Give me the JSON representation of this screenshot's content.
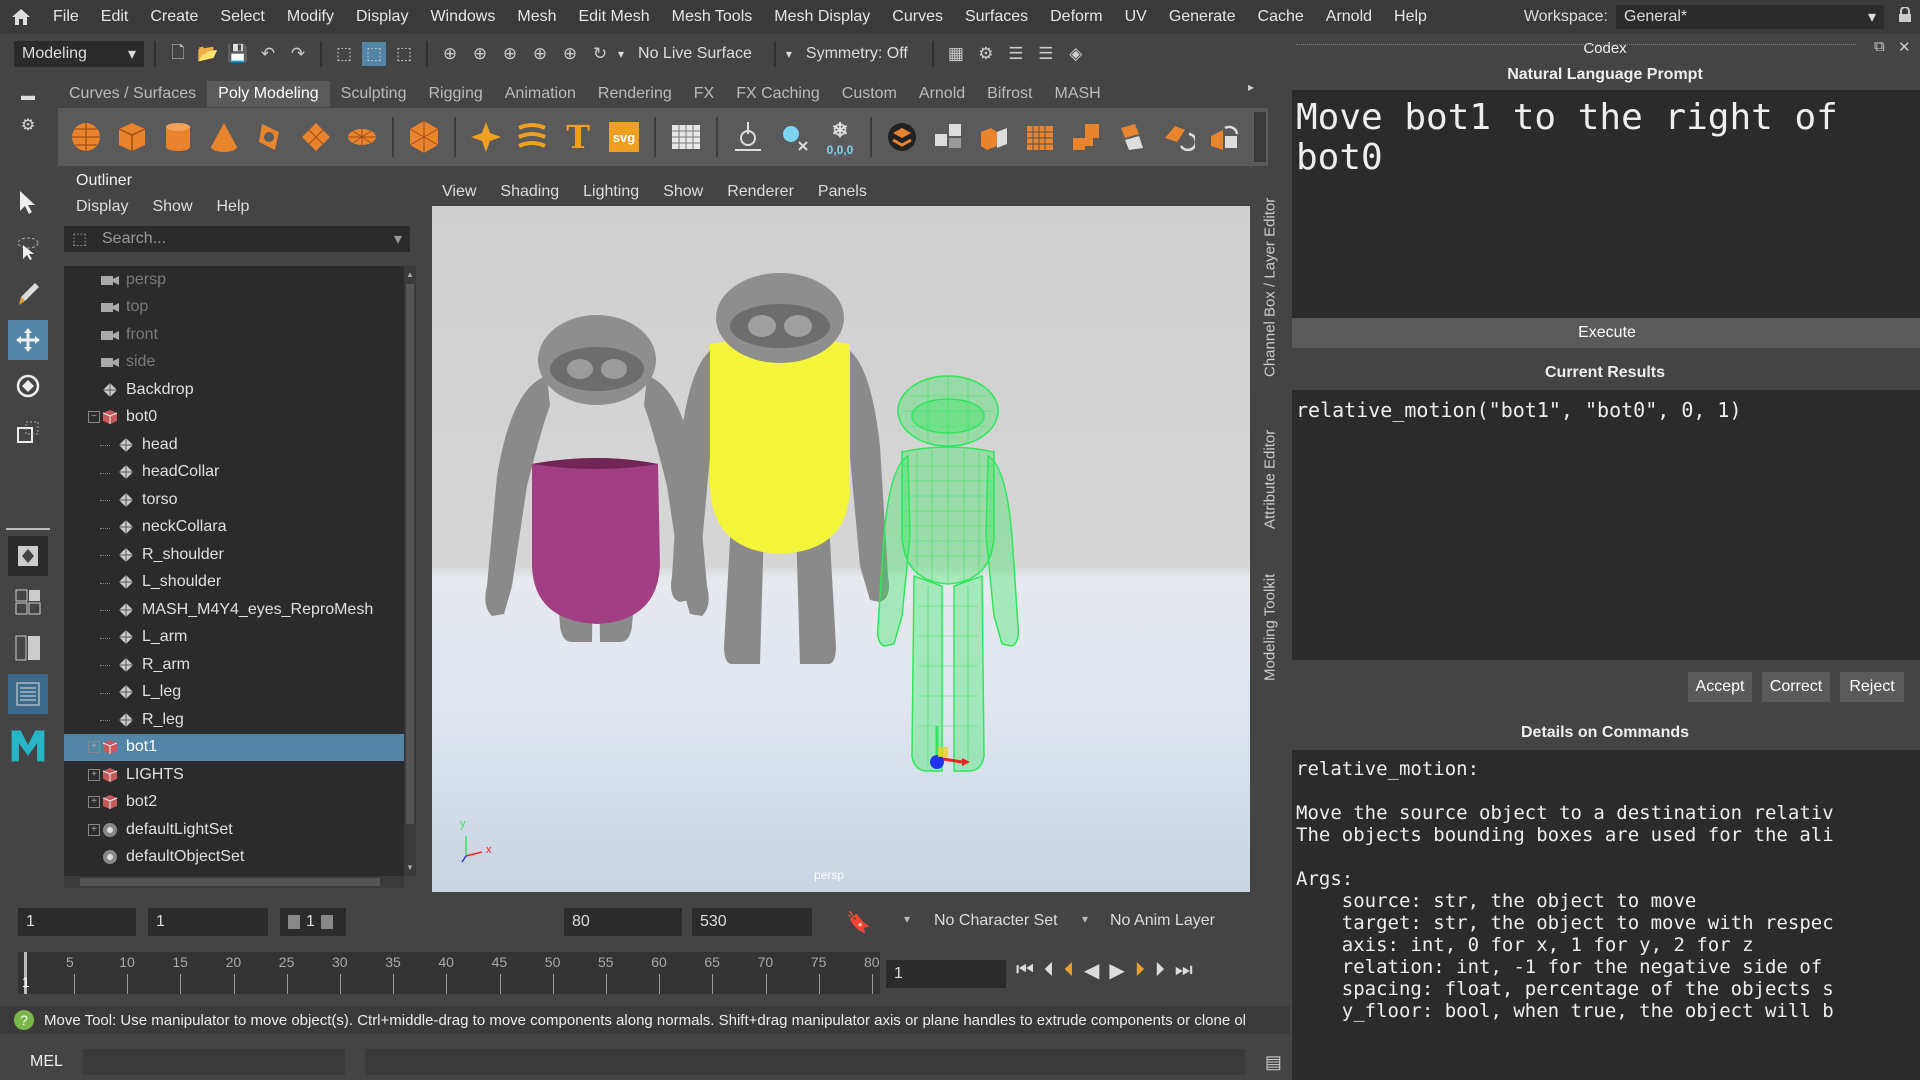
{
  "menubar": {
    "items": [
      "File",
      "Edit",
      "Create",
      "Select",
      "Modify",
      "Display",
      "Windows",
      "Mesh",
      "Edit Mesh",
      "Mesh Tools",
      "Mesh Display",
      "Curves",
      "Surfaces",
      "Deform",
      "UV",
      "Generate",
      "Cache",
      "Arnold",
      "Help"
    ],
    "workspace_label": "Workspace:",
    "workspace_value": "General*"
  },
  "statusline": {
    "mode": "Modeling",
    "live_surface": "No Live Surface",
    "symmetry": "Symmetry: Off"
  },
  "shelf": {
    "tabs": [
      "Curves / Surfaces",
      "Poly Modeling",
      "Sculpting",
      "Rigging",
      "Animation",
      "Rendering",
      "FX",
      "FX Caching",
      "Custom",
      "Arnold",
      "Bifrost",
      "MASH"
    ],
    "active_tab": "Poly Modeling",
    "text_icon": "T",
    "svg_icon": "svg",
    "coords_icon": "0,0,0"
  },
  "outliner": {
    "title": "Outliner",
    "menu": [
      "Display",
      "Show",
      "Help"
    ],
    "search_placeholder": "Search...",
    "tree": [
      {
        "label": "persp",
        "depth": 0,
        "icon": "camera-icon",
        "dim": true,
        "expander": ""
      },
      {
        "label": "top",
        "depth": 0,
        "icon": "camera-icon",
        "dim": true,
        "expander": ""
      },
      {
        "label": "front",
        "depth": 0,
        "icon": "camera-icon",
        "dim": true,
        "expander": ""
      },
      {
        "label": "side",
        "depth": 0,
        "icon": "camera-icon",
        "dim": true,
        "expander": ""
      },
      {
        "label": "Backdrop",
        "depth": 0,
        "icon": "mesh-icon",
        "dim": false,
        "expander": ""
      },
      {
        "label": "bot0",
        "depth": 0,
        "icon": "group-icon",
        "dim": false,
        "expander": "−"
      },
      {
        "label": "head",
        "depth": 1,
        "icon": "mesh-icon",
        "dim": false,
        "expander": ""
      },
      {
        "label": "headCollar",
        "depth": 1,
        "icon": "mesh-icon",
        "dim": false,
        "expander": ""
      },
      {
        "label": "torso",
        "depth": 1,
        "icon": "mesh-icon",
        "dim": false,
        "expander": ""
      },
      {
        "label": "neckCollara",
        "depth": 1,
        "icon": "mesh-icon",
        "dim": false,
        "expander": ""
      },
      {
        "label": "R_shoulder",
        "depth": 1,
        "icon": "mesh-icon",
        "dim": false,
        "expander": ""
      },
      {
        "label": "L_shoulder",
        "depth": 1,
        "icon": "mesh-icon",
        "dim": false,
        "expander": ""
      },
      {
        "label": "MASH_M4Y4_eyes_ReproMesh",
        "depth": 1,
        "icon": "mesh-icon",
        "dim": false,
        "expander": ""
      },
      {
        "label": "L_arm",
        "depth": 1,
        "icon": "mesh-icon",
        "dim": false,
        "expander": ""
      },
      {
        "label": "R_arm",
        "depth": 1,
        "icon": "mesh-icon",
        "dim": false,
        "expander": ""
      },
      {
        "label": "L_leg",
        "depth": 1,
        "icon": "mesh-icon",
        "dim": false,
        "expander": ""
      },
      {
        "label": "R_leg",
        "depth": 1,
        "icon": "mesh-icon",
        "dim": false,
        "expander": ""
      },
      {
        "label": "bot1",
        "depth": 0,
        "icon": "group-icon",
        "dim": false,
        "expander": "+",
        "selected": true
      },
      {
        "label": "LIGHTS",
        "depth": 0,
        "icon": "group-icon",
        "dim": false,
        "expander": "+"
      },
      {
        "label": "bot2",
        "depth": 0,
        "icon": "group-icon",
        "dim": false,
        "expander": "+"
      },
      {
        "label": "defaultLightSet",
        "depth": 0,
        "icon": "set-icon",
        "dim": false,
        "expander": "+"
      },
      {
        "label": "defaultObjectSet",
        "depth": 0,
        "icon": "set-icon",
        "dim": false,
        "expander": ""
      }
    ]
  },
  "viewport": {
    "menu": [
      "View",
      "Shading",
      "Lighting",
      "Show",
      "Renderer",
      "Panels"
    ],
    "camera_label": "persp",
    "axis_y": "y",
    "axis_x": "x",
    "bot_colors": {
      "bot0_torso": "#a23e83",
      "bot1_torso": "#f4f53a",
      "wire": "#2ee85a"
    }
  },
  "sidetabs": {
    "channel_box": "Channel Box / Layer Editor",
    "attribute_editor": "Attribute Editor",
    "modeling_toolkit": "Modeling Toolkit"
  },
  "timeline": {
    "start": "1",
    "range_start": "1",
    "range_field": "1",
    "range_end": "80",
    "end": "530",
    "character_set": "No Character Set",
    "anim_layer": "No Anim Layer",
    "current_frame": "1",
    "ruler_current": "1",
    "ticks": [
      "5",
      "10",
      "15",
      "20",
      "25",
      "30",
      "35",
      "40",
      "45",
      "50",
      "55",
      "60",
      "65",
      "70",
      "75",
      "80"
    ]
  },
  "helpline": {
    "text": "Move Tool: Use manipulator to move object(s). Ctrl+middle-drag to move components along normals. Shift+drag manipulator axis or plane handles to extrude components or clone ol"
  },
  "mel": {
    "label": "MEL"
  },
  "codex": {
    "title": "Codex",
    "prompt_label": "Natural Language Prompt",
    "prompt_text": "Move bot1 to the right of\nbot0",
    "execute_label": "Execute",
    "results_label": "Current Results",
    "results_text": "relative_motion(\"bot1\", \"bot0\", 0, 1)",
    "accept_label": "Accept",
    "correct_label": "Correct",
    "reject_label": "Reject",
    "details_label": "Details on Commands",
    "details_text": "relative_motion:\n\nMove the source object to a destination relativ\nThe objects bounding boxes are used for the ali\n\nArgs:\n    source: str, the object to move\n    target: str, the object to move with respec\n    axis: int, 0 for x, 1 for y, 2 for z\n    relation: int, -1 for the negative side of \n    spacing: float, percentage of the objects s\n    y_floor: bool, when true, the object will b"
  }
}
